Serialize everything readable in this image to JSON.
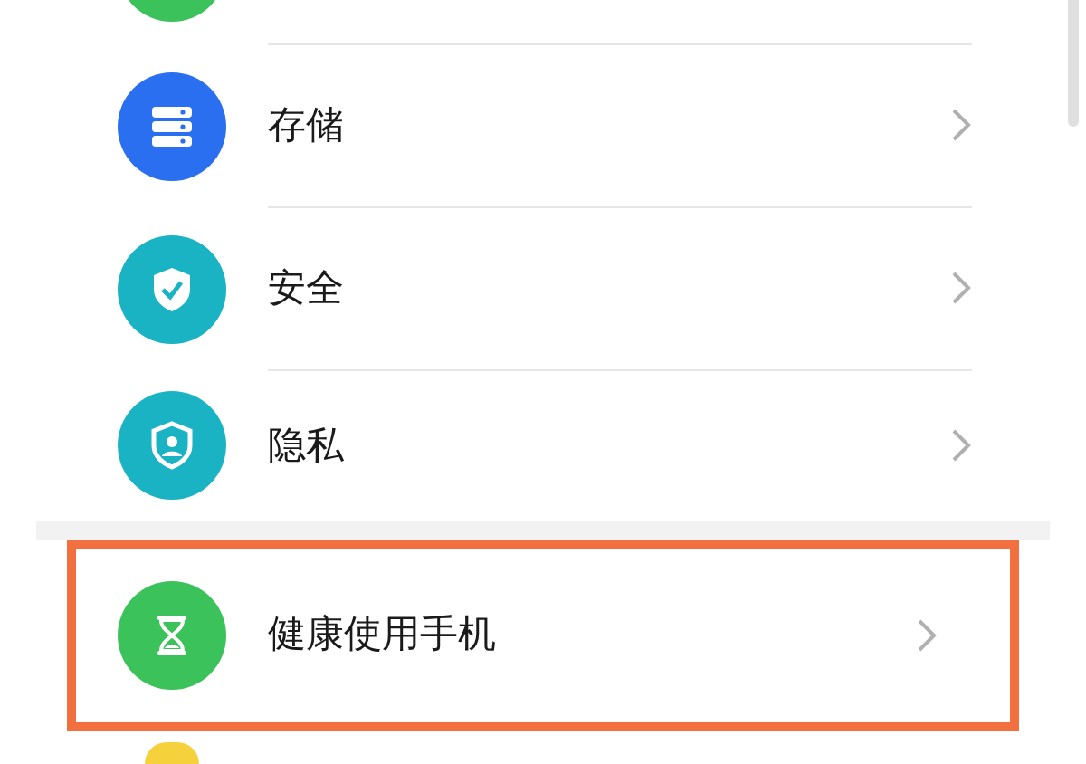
{
  "settings": [
    {
      "label": "存储",
      "kind": "storage",
      "color": "#2a6ff0",
      "highlighted": false
    },
    {
      "label": "安全",
      "kind": "security",
      "color": "#1ab3c4",
      "highlighted": false
    },
    {
      "label": "隐私",
      "kind": "privacy",
      "color": "#1ab3c4",
      "highlighted": false
    }
  ],
  "featured": [
    {
      "label": "健康使用手机",
      "kind": "hourglass",
      "color": "#3cc25a",
      "highlighted": true
    }
  ]
}
